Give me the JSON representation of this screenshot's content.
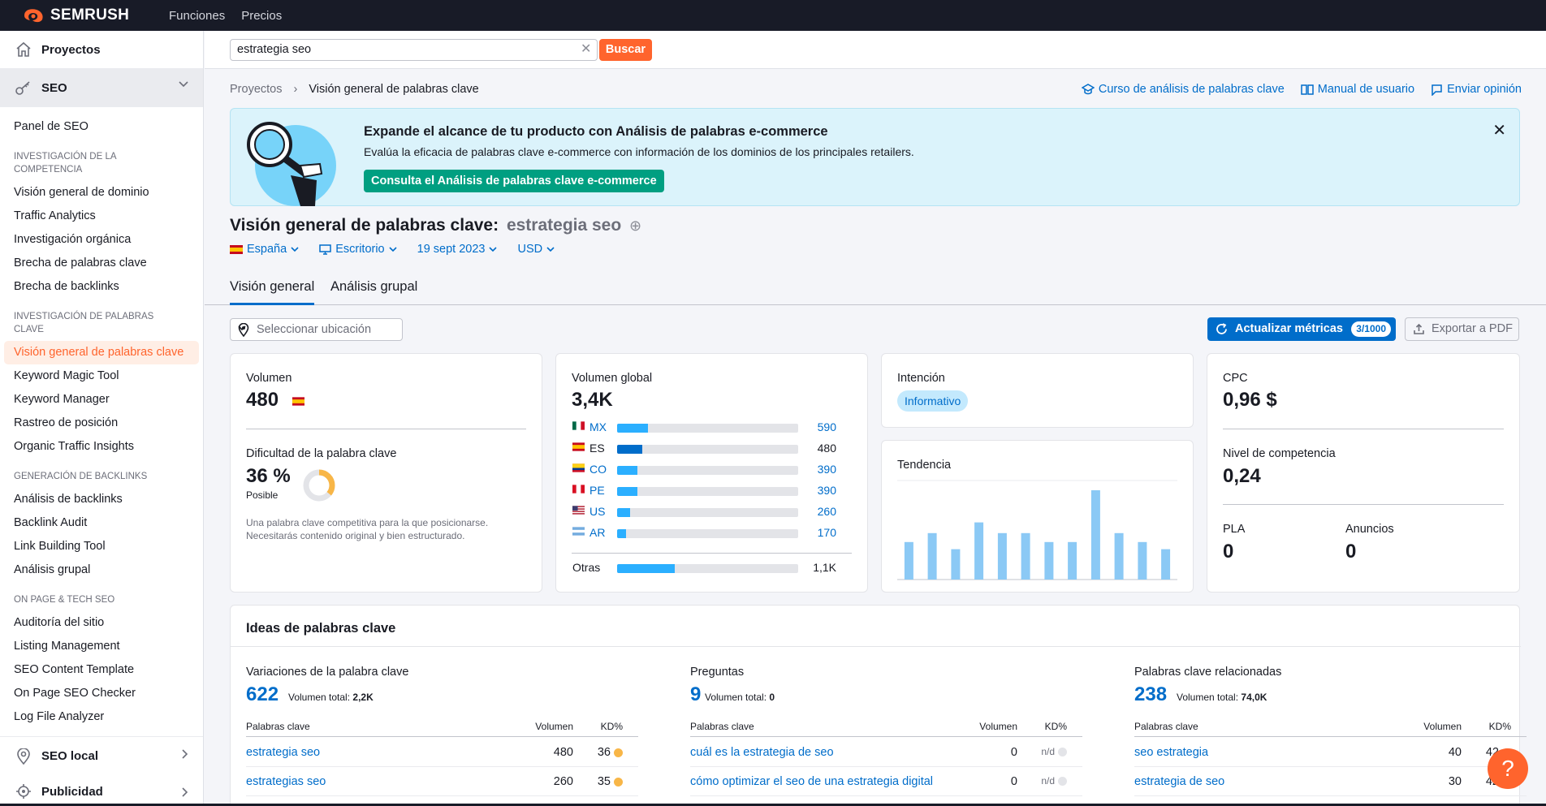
{
  "topbar": {
    "brand": "SEMRUSH",
    "nav": [
      "Funciones",
      "Precios"
    ]
  },
  "sidebar": {
    "projects": "Proyectos",
    "seo": "SEO",
    "top_item": "Panel de SEO",
    "groups": [
      {
        "title": "INVESTIGACIÓN DE LA COMPETENCIA",
        "items": [
          "Visión general de dominio",
          "Traffic Analytics",
          "Investigación orgánica",
          "Brecha de palabras clave",
          "Brecha de backlinks"
        ]
      },
      {
        "title": "INVESTIGACIÓN DE PALABRAS CLAVE",
        "items": [
          "Visión general de palabras clave",
          "Keyword Magic Tool",
          "Keyword Manager",
          "Rastreo de posición",
          "Organic Traffic Insights"
        ]
      },
      {
        "title": "GENERACIÓN DE BACKLINKS",
        "items": [
          "Análisis de backlinks",
          "Backlink Audit",
          "Link Building Tool",
          "Análisis grupal"
        ]
      },
      {
        "title": "ON PAGE & TECH SEO",
        "items": [
          "Auditoría del sitio",
          "Listing Management",
          "SEO Content Template",
          "On Page SEO Checker",
          "Log File Analyzer"
        ]
      }
    ],
    "local": "SEO local",
    "ads": "Publicidad"
  },
  "search": {
    "value": "estrategia seo",
    "button": "Buscar"
  },
  "breadcrumb": {
    "root": "Proyectos",
    "current": "Visión general de palabras clave"
  },
  "toplinks": [
    "Curso de análisis de palabras clave",
    "Manual de usuario",
    "Enviar opinión"
  ],
  "banner": {
    "title": "Expande el alcance de tu producto con Análisis de palabras e-commerce",
    "text": "Evalúa la eficacia de palabras clave e-commerce con información de los dominios de los principales retailers.",
    "button": "Consulta el Análisis de palabras clave e-commerce"
  },
  "page": {
    "title": "Visión general de palabras clave:",
    "keyword": "estrategia seo"
  },
  "filters": {
    "country": "España",
    "device": "Escritorio",
    "date": "19 sept 2023",
    "currency": "USD"
  },
  "tabs": [
    "Visión general",
    "Análisis grupal"
  ],
  "location": {
    "placeholder": "Seleccionar ubicación"
  },
  "actions": {
    "update": "Actualizar métricas",
    "quota": "3/1000",
    "export": "Exportar a PDF"
  },
  "volume": {
    "label": "Volumen",
    "value": "480"
  },
  "kd": {
    "label": "Dificultad de la palabra clave",
    "value": "36 %",
    "percent": 36,
    "status": "Posible",
    "desc": "Una palabra clave competitiva para la que posicionarse. Necesitarás contenido original y bien estructurado."
  },
  "global": {
    "label": "Volumen global",
    "value": "3,4K",
    "countries": [
      {
        "code": "MX",
        "value": "590",
        "share": 0.17
      },
      {
        "code": "ES",
        "value": "480",
        "share": 0.14
      },
      {
        "code": "CO",
        "value": "390",
        "share": 0.11
      },
      {
        "code": "PE",
        "value": "390",
        "share": 0.11
      },
      {
        "code": "US",
        "value": "260",
        "share": 0.07
      },
      {
        "code": "AR",
        "value": "170",
        "share": 0.05
      }
    ],
    "other_label": "Otras",
    "other_value": "1,1K",
    "other_share": 0.32
  },
  "intent": {
    "label": "Intención",
    "value": "Informativo"
  },
  "trend": {
    "label": "Tendencia",
    "values": [
      0.42,
      0.52,
      0.34,
      0.64,
      0.52,
      0.52,
      0.42,
      0.42,
      1.0,
      0.52,
      0.42,
      0.34
    ]
  },
  "cpc": {
    "label": "CPC",
    "value": "0,96 $"
  },
  "competition": {
    "label": "Nivel de competencia",
    "value": "0,24"
  },
  "pla": {
    "label": "PLA",
    "value": "0"
  },
  "ads": {
    "label": "Anuncios",
    "value": "0"
  },
  "ideas": {
    "title": "Ideas de palabras clave",
    "columns": [
      {
        "title": "Variaciones de la palabra clave",
        "count": "622",
        "vol_label": "Volumen total:",
        "vol": "2,2K",
        "rows": [
          {
            "kw": "estrategia seo",
            "vol": "480",
            "kd": "36"
          },
          {
            "kw": "estrategias seo",
            "vol": "260",
            "kd": "35"
          }
        ]
      },
      {
        "title": "Preguntas",
        "count": "9",
        "vol_label": "Volumen total:",
        "vol": "0",
        "rows": [
          {
            "kw": "cuál es la estrategia de seo",
            "vol": "0",
            "kd": "n/d"
          },
          {
            "kw": "cómo optimizar el seo de una estrategia digital",
            "vol": "0",
            "kd": "n/d"
          }
        ]
      },
      {
        "title": "Palabras clave relacionadas",
        "count": "238",
        "vol_label": "Volumen total:",
        "vol": "74,0K",
        "rows": [
          {
            "kw": "seo estrategia",
            "vol": "40",
            "kd": "42"
          },
          {
            "kw": "estrategia de seo",
            "vol": "30",
            "kd": "42"
          }
        ]
      }
    ],
    "headers": {
      "kw": "Palabras clave",
      "vol": "Volumen",
      "kd": "KD%"
    }
  },
  "help": "?"
}
